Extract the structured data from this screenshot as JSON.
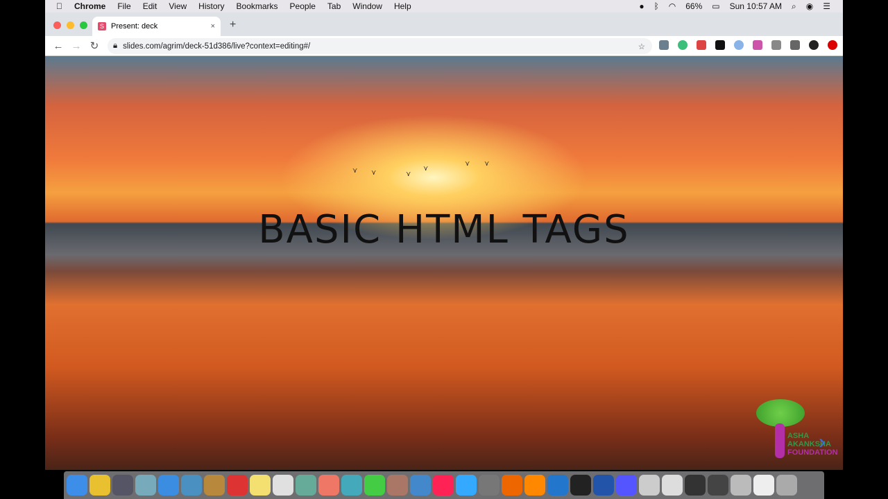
{
  "menubar": {
    "app": "Chrome",
    "items": [
      "File",
      "Edit",
      "View",
      "History",
      "Bookmarks",
      "People",
      "Tab",
      "Window",
      "Help"
    ],
    "battery": "66%",
    "clock": "Sun 10:57 AM"
  },
  "tab": {
    "favicon": "S",
    "title": "Present: deck",
    "close": "×",
    "new": "+"
  },
  "address": {
    "url": "slides.com/agrim/deck-51d386/live?context=editing#/"
  },
  "slide": {
    "title": "BASIC HTML TAGS",
    "next": "›"
  },
  "logo": {
    "lines": [
      "ASHA",
      "AKANKSHA",
      "FOUNDATION"
    ]
  },
  "colors": {
    "extensions": [
      "#6b7f8e",
      "#3cbf7a",
      "#d44",
      "#111",
      "#8ab4e8",
      "#c5a",
      "#888",
      "#666",
      "#222",
      "#d00"
    ],
    "dock": [
      "#3d8ee8",
      "#e8c030",
      "#556",
      "#7ab",
      "#3a8de0",
      "#4a90c0",
      "#b8893c",
      "#d33",
      "#f3e070",
      "#e0e0e0",
      "#6a9",
      "#e76",
      "#4ab",
      "#4c4",
      "#a76",
      "#48c",
      "#f25",
      "#3af",
      "#777",
      "#e60",
      "#f80",
      "#27c",
      "#222",
      "#25a",
      "#55f",
      "#ccc",
      "#ddd",
      "#333",
      "#444",
      "#bbb",
      "#eee",
      "#aaa"
    ]
  }
}
